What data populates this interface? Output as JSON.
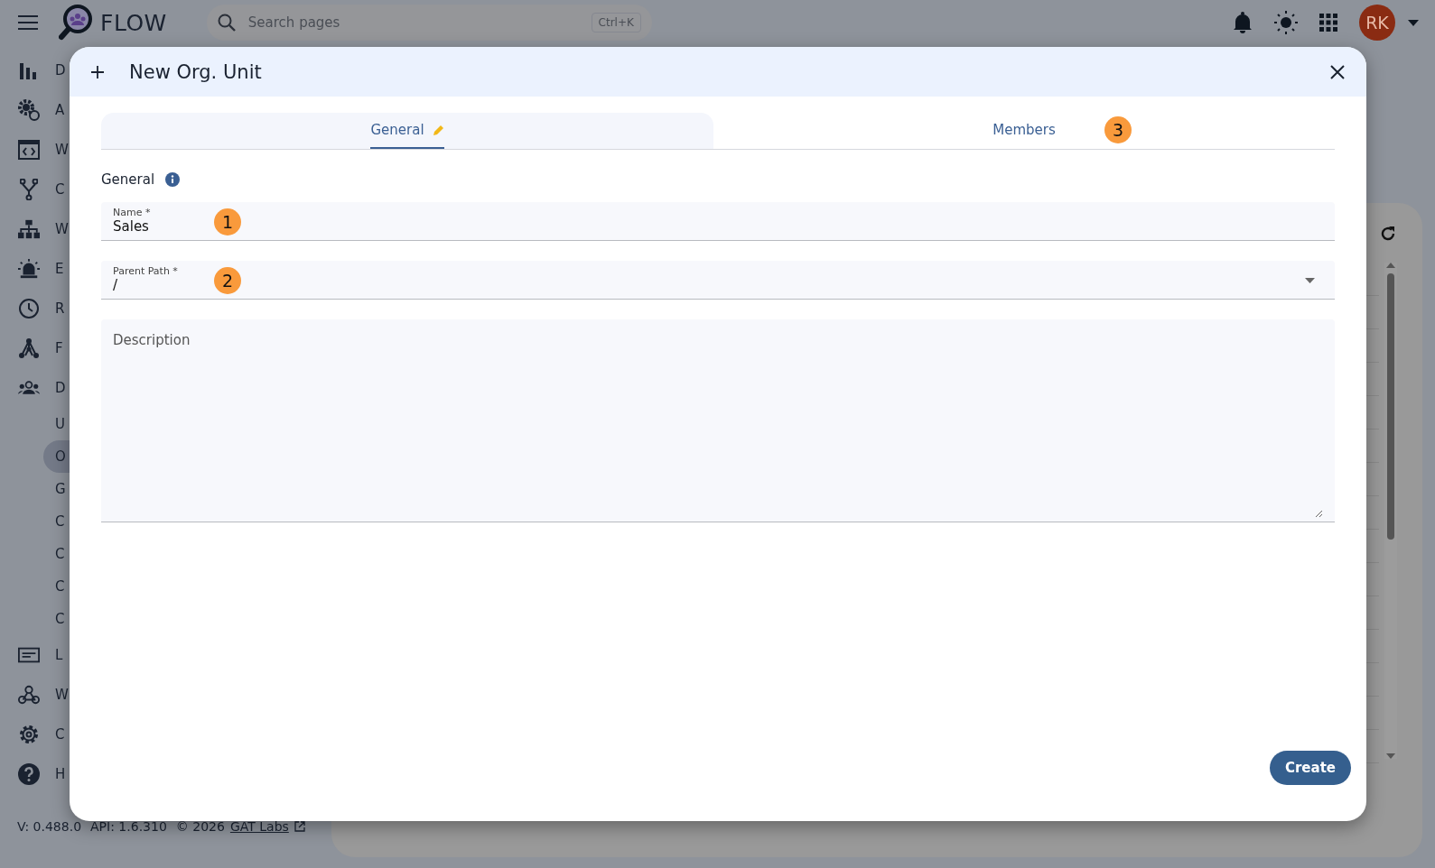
{
  "app_bar": {
    "brand": "FLOW",
    "search": {
      "placeholder": "Search pages",
      "shortcut": "Ctrl+K"
    },
    "avatar": "RK"
  },
  "sidebar": {
    "items": [
      {
        "label": "D",
        "kind": "chart"
      },
      {
        "label": "A",
        "kind": "gears"
      },
      {
        "label": "W",
        "kind": "code-window"
      },
      {
        "label": "C",
        "kind": "branch"
      },
      {
        "label": "W",
        "kind": "hierarchy"
      },
      {
        "label": "E",
        "kind": "siren"
      },
      {
        "label": "R",
        "kind": "clock"
      },
      {
        "label": "F",
        "kind": "graph"
      },
      {
        "label": "D",
        "kind": "people",
        "children": [
          {
            "label": "U",
            "selected": false
          },
          {
            "label": "O",
            "selected": true
          },
          {
            "label": "G",
            "selected": false
          },
          {
            "label": "C",
            "selected": false
          },
          {
            "label": "C",
            "selected": false
          },
          {
            "label": "C",
            "selected": false
          },
          {
            "label": "C",
            "selected": false
          }
        ]
      },
      {
        "label": "L",
        "kind": "card"
      },
      {
        "label": "W",
        "kind": "webhook"
      },
      {
        "label": "C",
        "kind": "settings"
      },
      {
        "label": "H",
        "kind": "help"
      }
    ]
  },
  "footer": {
    "version": "V: 0.488.0",
    "api": "API: 1.6.310",
    "copyright": "© 2026",
    "link": "GAT Labs"
  },
  "dialog": {
    "title": "New Org. Unit",
    "tabs": [
      {
        "label": "General",
        "selected": true,
        "edited": true
      },
      {
        "label": "Members",
        "selected": false,
        "edited": false,
        "marker": "3"
      }
    ],
    "section": "General",
    "fields": [
      {
        "kind": "text",
        "label": "Name *",
        "value": "Sales",
        "marker": "1"
      },
      {
        "kind": "select",
        "label": "Parent Path *",
        "value": "/",
        "marker": "2"
      },
      {
        "kind": "textarea",
        "placeholder": "Description"
      }
    ],
    "primary_button": "Create"
  }
}
